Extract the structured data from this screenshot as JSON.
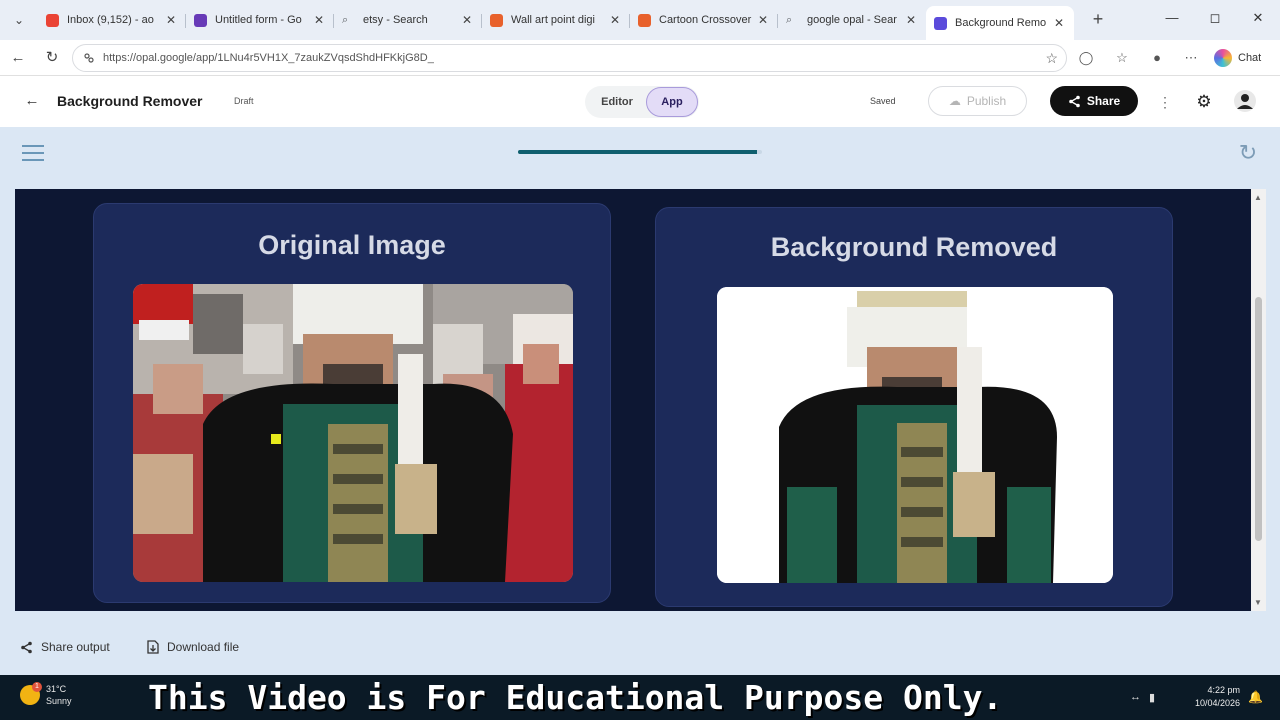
{
  "browser": {
    "tabs": [
      {
        "title": "Inbox (9,152) - ao",
        "favicon_color": "#ea4335"
      },
      {
        "title": "Untitled form - Go",
        "favicon_color": "#673ab7"
      },
      {
        "title": "etsy - Search",
        "favicon_color": "#5f6368",
        "icon": "search-icon"
      },
      {
        "title": "Wall art point digi",
        "favicon_color": "#e8612c"
      },
      {
        "title": "Cartoon Crossover",
        "favicon_color": "#e8612c"
      },
      {
        "title": "google opal - Sear",
        "favicon_color": "#5f6368",
        "icon": "search-icon"
      },
      {
        "title": "Background Remo",
        "favicon_color": "#5b4bdb",
        "active": true
      }
    ],
    "url": "https://opal.google/app/1LNu4r5VH1X_7zaukZVqsdShdHFKkjG8D_",
    "chat_label": "Chat"
  },
  "app": {
    "title": "Background Remover",
    "status": "Draft",
    "mode_editor": "Editor",
    "mode_app": "App",
    "save_state": "Saved",
    "publish_label": "Publish",
    "share_label": "Share",
    "progress_fraction": 0.98
  },
  "output": {
    "original_title": "Original Image",
    "removed_title": "Background Removed"
  },
  "actions": {
    "share_output": "Share output",
    "download_file": "Download file"
  },
  "taskbar": {
    "temperature": "31°C",
    "weather": "Sunny",
    "weather_badge": "1",
    "banner": "This Video is For Educational Purpose Only.",
    "time": "4:22 pm",
    "date": "10/04/2026"
  },
  "colors": {
    "accent": "#0f5f6e",
    "app_bg": "#dbe7f4",
    "frame_bg": "#0d1733",
    "panel_bg": "#1c2a5a"
  }
}
